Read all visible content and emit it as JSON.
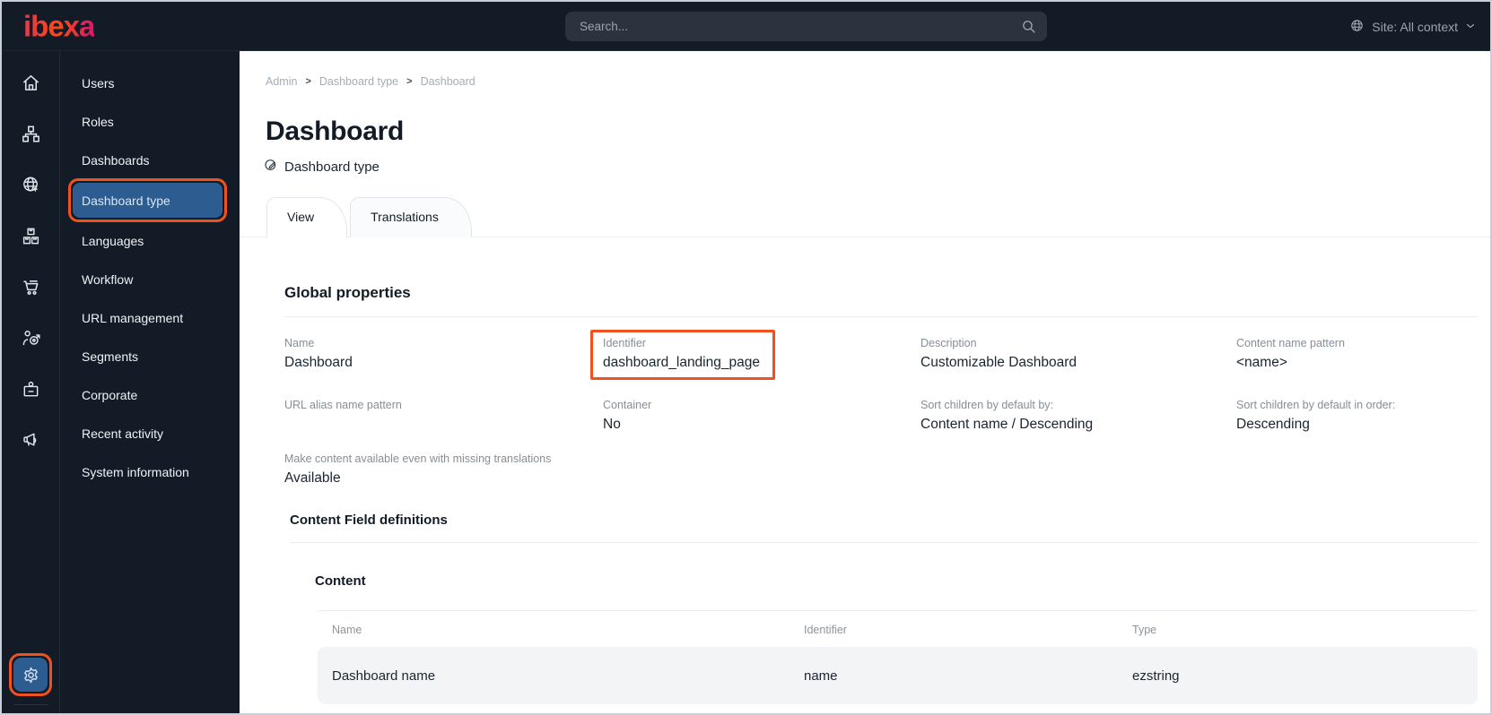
{
  "topbar": {
    "logo_text": "ibexa",
    "search_placeholder": "Search...",
    "site_context_label": "Site: All context"
  },
  "rail": {
    "icons": [
      "home",
      "content-structure",
      "site",
      "product-catalog",
      "commerce",
      "personalization",
      "corporate-account",
      "promotions"
    ],
    "settings_icon": "settings"
  },
  "sidebar": {
    "items": [
      {
        "label": "Users",
        "selected": false
      },
      {
        "label": "Roles",
        "selected": false
      },
      {
        "label": "Dashboards",
        "selected": false
      },
      {
        "label": "Dashboard type",
        "selected": true
      },
      {
        "label": "Languages",
        "selected": false
      },
      {
        "label": "Workflow",
        "selected": false
      },
      {
        "label": "URL management",
        "selected": false
      },
      {
        "label": "Segments",
        "selected": false
      },
      {
        "label": "Corporate",
        "selected": false
      },
      {
        "label": "Recent activity",
        "selected": false
      },
      {
        "label": "System information",
        "selected": false
      }
    ]
  },
  "breadcrumb": {
    "separator": ">",
    "items": [
      "Admin",
      "Dashboard type",
      "Dashboard"
    ]
  },
  "page": {
    "title": "Dashboard",
    "type_label": "Dashboard type"
  },
  "tabs": [
    {
      "label": "View",
      "active": true
    },
    {
      "label": "Translations",
      "active": false
    }
  ],
  "global_properties": {
    "heading": "Global properties",
    "fields": [
      {
        "label": "Name",
        "value": "Dashboard"
      },
      {
        "label": "Identifier",
        "value": "dashboard_landing_page",
        "highlighted": true
      },
      {
        "label": "Description",
        "value": "Customizable Dashboard"
      },
      {
        "label": "Content name pattern",
        "value": "<name>"
      },
      {
        "label": "URL alias name pattern",
        "value": ""
      },
      {
        "label": "Container",
        "value": "No"
      },
      {
        "label": "Sort children by default by:",
        "value": "Content name / Descending"
      },
      {
        "label": "Sort children by default in order:",
        "value": "Descending"
      },
      {
        "label": "Make content available even with missing translations",
        "value": "Available"
      }
    ]
  },
  "field_definitions": {
    "heading": "Content Field definitions",
    "group": {
      "heading": "Content",
      "table": {
        "headers": [
          "Name",
          "Identifier",
          "Type"
        ],
        "rows": [
          {
            "name": "Dashboard name",
            "identifier": "name",
            "type": "ezstring"
          }
        ]
      }
    }
  },
  "colors": {
    "accent_orange": "#f0511f",
    "selected_blue": "#2d5c90",
    "topbar_bg": "#131c26"
  }
}
